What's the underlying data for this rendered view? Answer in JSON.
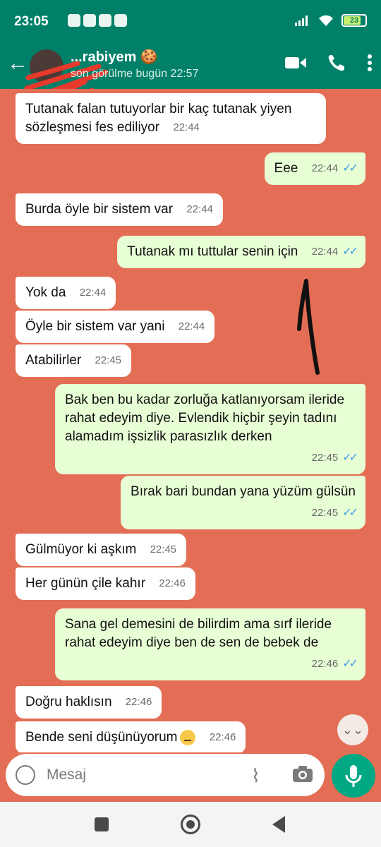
{
  "status_bar": {
    "time": "23:05",
    "battery": "23"
  },
  "header": {
    "contact_name": "...rabiyem 🍪",
    "last_seen": "son görülme bugün 22:57"
  },
  "messages": [
    {
      "dir": "in",
      "text": "Tutanak falan tutuyorlar bir kaç tutanak yiyen sözleşmesi fes ediliyor",
      "time": "22:44"
    },
    {
      "dir": "out",
      "text": "Eee",
      "time": "22:44"
    },
    {
      "dir": "in",
      "text": "Burda öyle bir sistem var",
      "time": "22:44"
    },
    {
      "dir": "out",
      "text": "Tutanak mı tuttular senin için",
      "time": "22:44"
    },
    {
      "dir": "in",
      "text": "Yok da",
      "time": "22:44"
    },
    {
      "dir": "in",
      "text": "Öyle bir sistem var yani",
      "time": "22:44"
    },
    {
      "dir": "in",
      "text": "Atabilirler",
      "time": "22:45"
    },
    {
      "dir": "out",
      "text": "Bak ben bu kadar zorluğa katlanıyorsam ileride rahat edeyim diye. Evlendik hiçbir şeyin tadını alamadım işsizlik parasızlık derken",
      "time": "22:45"
    },
    {
      "dir": "out",
      "text": "Bırak bari bundan yana yüzüm gülsün",
      "time": "22:45"
    },
    {
      "dir": "in",
      "text": "Gülmüyor ki aşkım",
      "time": "22:45"
    },
    {
      "dir": "in",
      "text": "Her günün çile kahır",
      "time": "22:46"
    },
    {
      "dir": "out",
      "text": "Sana gel demesini de bilirdim ama sırf ileride rahat edeyim diye ben de sen de bebek de",
      "time": "22:46"
    },
    {
      "dir": "in",
      "text": "Doğru haklısın",
      "time": "22:46"
    },
    {
      "dir": "in",
      "text": "Bende seni düşünüyorum",
      "time": "22:46"
    }
  ],
  "composer": {
    "placeholder": "Mesaj"
  },
  "colors": {
    "header": "#008069",
    "chat_background": "#e36e55",
    "outgoing_bubble": "#e8ffd6",
    "incoming_bubble": "#ffffff",
    "read_ticks": "#3a9be6",
    "mic_button": "#00a884"
  },
  "icons": [
    "back-arrow-icon",
    "video-call-icon",
    "phone-icon",
    "more-vertical-icon",
    "emoji-icon",
    "attach-icon",
    "camera-icon",
    "mic-icon",
    "scroll-down-icon",
    "nav-recent-icon",
    "nav-home-icon",
    "nav-back-icon"
  ]
}
